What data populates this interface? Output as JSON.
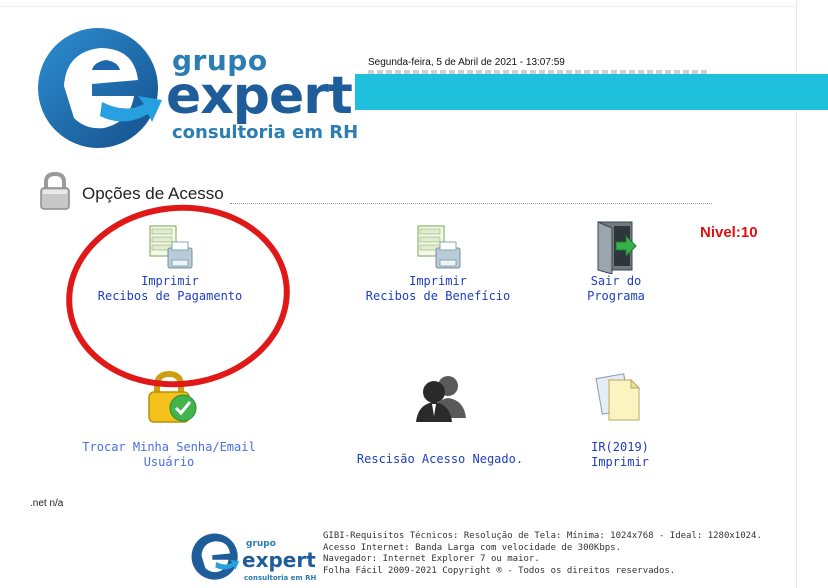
{
  "header": {
    "logo": {
      "line1": "grupo",
      "line2": "expert",
      "line3": "consultoria em RH"
    },
    "date": "Segunda-feira, 5 de Abril de 2021 -  13:07:59"
  },
  "section": {
    "title": "Opções de Acesso"
  },
  "nivel": "Nivel:10",
  "items": [
    {
      "line1": "Imprimir",
      "line2": "Recibos de Pagamento"
    },
    {
      "line1": "Imprimir",
      "line2": "Recibos de Benefício"
    },
    {
      "line1": "Sair do",
      "line2": "Programa"
    },
    {
      "line1": "Trocar Minha Senha/Email",
      "line2": "Usuário"
    },
    {
      "line1": "Rescisão Acesso Negado.",
      "line2": ""
    },
    {
      "line1": "IR(2019)",
      "line2": "Imprimir"
    }
  ],
  "status": ".net n/a",
  "footer": {
    "logo": {
      "line1": "grupo",
      "line2": "expert",
      "line3": "consultoria em RH"
    },
    "lines": [
      "GIBI-Requisitos Técnicos: Resolução de Tela: Mínima: 1024x768 - Ideal: 1280x1024.",
      "Acesso Internet: Banda Larga com velocidade de 300Kbps.",
      "Navegador: Internet Explorer 7 ou maior.",
      "Folha Fácil 2009-2021 Copyright ® - Todos os direitos reservados."
    ]
  },
  "colors": {
    "accent": "#1fc0dc",
    "link": "#1f3fbf",
    "nivel": "#e01010",
    "brand": "#1e5d9a"
  }
}
